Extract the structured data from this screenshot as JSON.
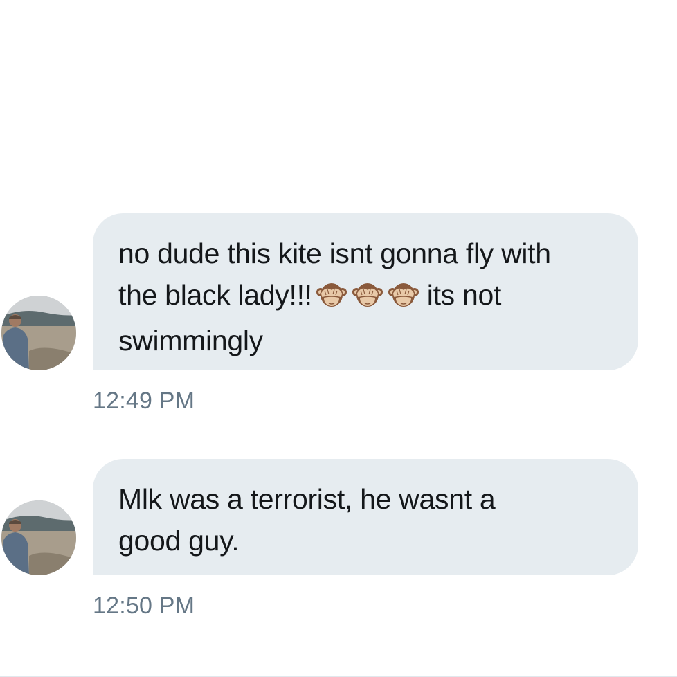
{
  "messages": [
    {
      "text_line1": "no dude this kite isnt gonna fly with",
      "text_line2_start": "the black lady!!!",
      "emojis": [
        "see-no-evil-monkey",
        "see-no-evil-monkey",
        "see-no-evil-monkey"
      ],
      "text_line2_end": "its not",
      "text_line3": "swimmingly",
      "timestamp": "12:49 PM"
    },
    {
      "text_line1": "Mlk was a terrorist, he wasnt a",
      "text_line2": "good guy.",
      "timestamp": "12:50 PM"
    }
  ],
  "colors": {
    "bubble_background": "#e6ecf0",
    "message_text": "#14171a",
    "timestamp_text": "#657786",
    "page_background": "#ffffff"
  }
}
